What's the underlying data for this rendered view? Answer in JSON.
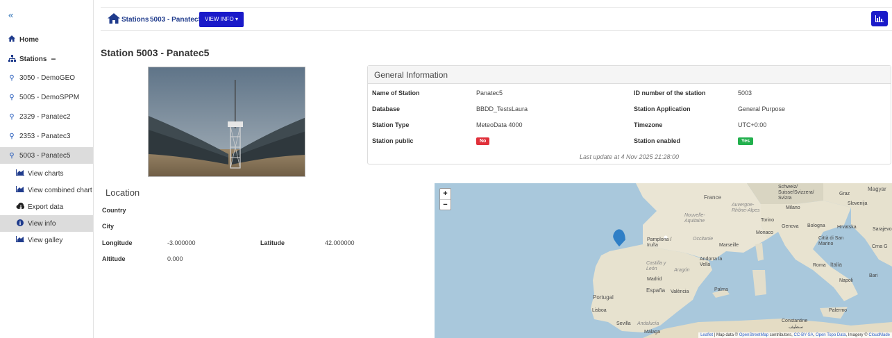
{
  "sidebar": {
    "collapse_icon": "«",
    "home_label": "Home",
    "stations_label": "Stations",
    "stations_toggle": "−",
    "stations": [
      {
        "label": "3050 - DemoGEO"
      },
      {
        "label": "5005 - DemoSPPM"
      },
      {
        "label": "2329 - Panatec2"
      },
      {
        "label": "2353 - Panatec3"
      },
      {
        "label": "5003 - Panatec5"
      }
    ],
    "subitems": [
      {
        "label": "View charts",
        "icon": "area-chart-icon"
      },
      {
        "label": "View combined chart",
        "icon": "area-chart-icon"
      },
      {
        "label": "Export data",
        "icon": "cloud-download-icon"
      },
      {
        "label": "View info",
        "icon": "info-circle-icon"
      },
      {
        "label": "View galley",
        "icon": "area-chart-icon"
      }
    ]
  },
  "topbar": {
    "crumb_stations": "Stations",
    "crumb_current": "5003 - Panatec5",
    "view_info_label": "VIEW INFO ▾"
  },
  "page": {
    "title": "Station 5003 - Panatec5"
  },
  "general_info": {
    "title": "General Information",
    "name_label": "Name of Station",
    "name_value": "Panatec5",
    "id_label": "ID number of the station",
    "id_value": "5003",
    "db_label": "Database",
    "db_value": "BBDD_TestsLaura",
    "app_label": "Station Application",
    "app_value": "General Purpose",
    "type_label": "Station Type",
    "type_value": "MeteoData 4000",
    "tz_label": "Timezone",
    "tz_value": "UTC+0:00",
    "public_label": "Station public",
    "public_value": "No",
    "enabled_label": "Station enabled",
    "enabled_value": "Yes",
    "last_update": "Last update at 4 Nov 2025 21:28:00"
  },
  "location": {
    "title": "Location",
    "country_label": "Country",
    "city_label": "City",
    "lon_label": "Longitude",
    "lon_value": "-3.000000",
    "lat_label": "Latitude",
    "lat_value": "42.000000",
    "alt_label": "Altitude",
    "alt_value": "0.000"
  },
  "map": {
    "zoom_in": "+",
    "zoom_out": "−",
    "attribution_leaflet": "Leaflet",
    "attribution_text1": " | Map data © ",
    "attribution_osm": "OpenStreetMap",
    "attribution_text2": " contributors, ",
    "attribution_license": "CC-BY-SA",
    "attribution_text3": ", ",
    "attribution_topo": "Open Topo Data",
    "attribution_text4": ", Imagery © ",
    "attribution_cloudmade": "CloudMade",
    "labels": {
      "france": "France",
      "schweiz": "Schweiz/ Suisse/Svizzera/ Svizra",
      "graz": "Graz",
      "magyar": "Magyar",
      "slovenija": "Slovenija",
      "milano": "Milano",
      "torino": "Torino",
      "genova": "Genova",
      "bologna": "Bologna",
      "hrvatska": "Hrvatska",
      "sarajevo": "Sarajevo",
      "monaco": "Monaco",
      "citta": "Città di San Marino",
      "crna": "Crna G",
      "pamplona": "Pamplona / Iruña",
      "marseille": "Marseille",
      "andorra": "Andorra la Vella",
      "occitanie": "Occitanie",
      "nouvelle": "Nouvelle-Aquitaine",
      "auvergne": "Auvergne-Rhône-Alpes",
      "castilla": "Castilla y León",
      "aragon": "Aragón",
      "roma": "Roma",
      "italia": "Italia",
      "bari": "Bari",
      "madrid": "Madrid",
      "espana": "España",
      "valencia": "València",
      "palma": "Palma",
      "napoli": "Napoli",
      "portugal": "Portugal",
      "lisboa": "Lisboa",
      "sevilla": "Sevilla",
      "andalucia": "Andalucía",
      "malaga": "Málaga",
      "palermo": "Palermo",
      "constantine": "Constantine",
      "setif": "سطيف"
    }
  }
}
